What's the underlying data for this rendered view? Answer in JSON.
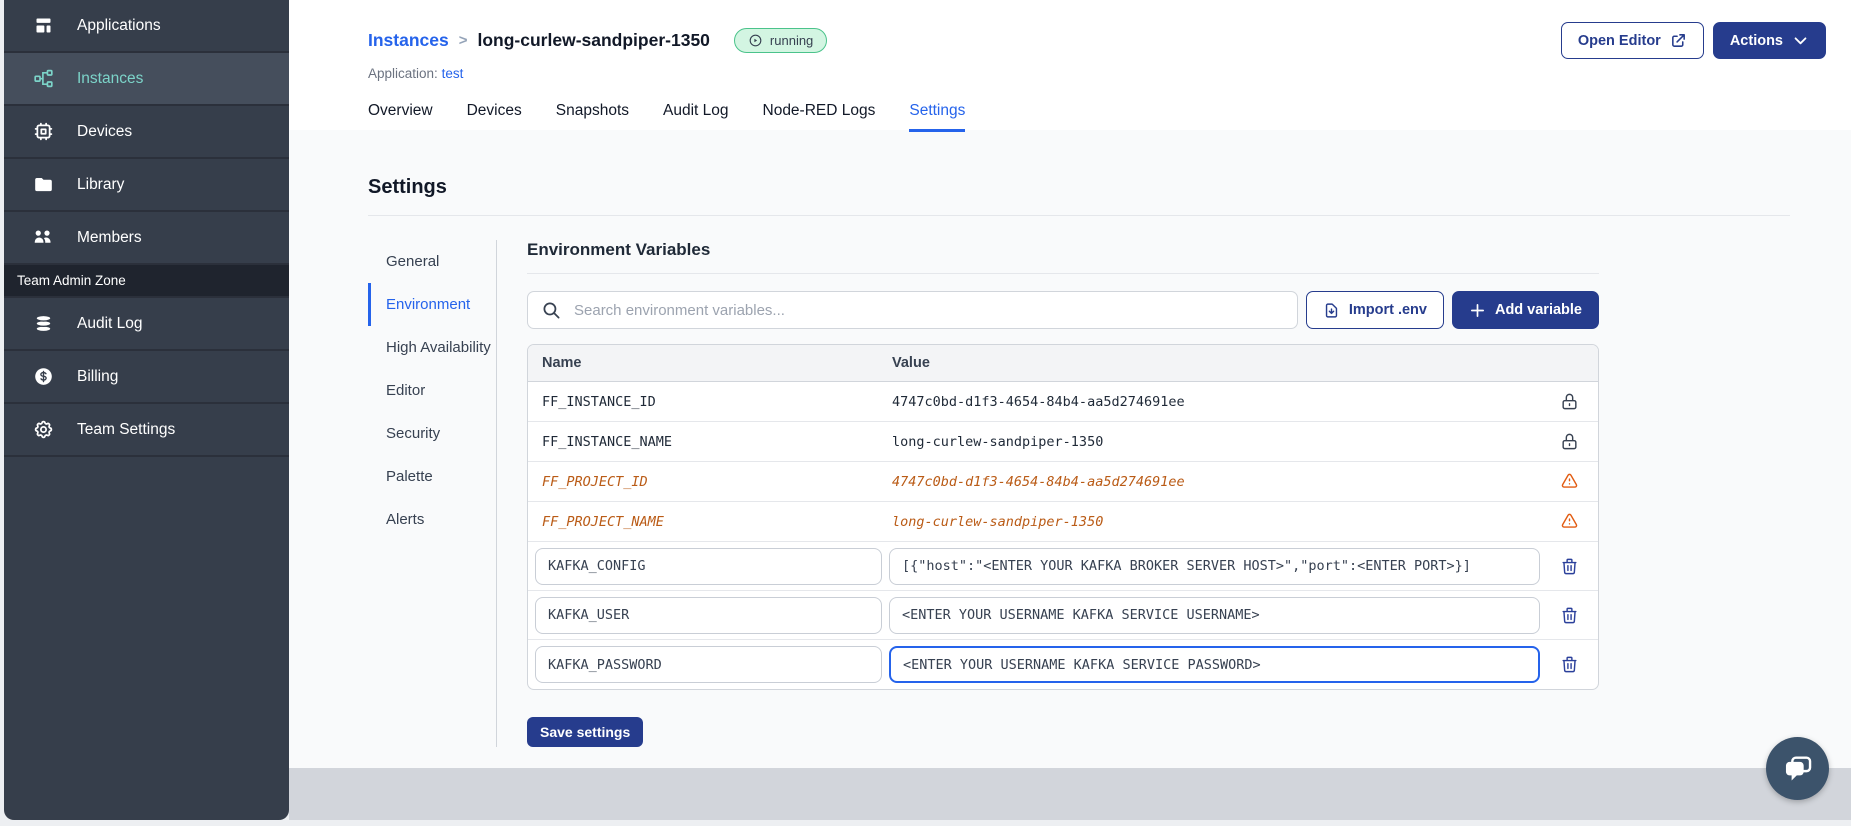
{
  "colors": {
    "brand_navy": "#263C8D",
    "link_blue": "#2563EB",
    "sidebar_bg": "#363E4B",
    "sidebar_active_teal": "#7CD4C9",
    "status_green_bg": "#D3F5E2",
    "status_green_border": "#4BC38B",
    "deprecated_orange": "#BA5B16",
    "warning_orange": "#E25C12"
  },
  "sidebar": {
    "items": [
      {
        "label": "Applications"
      },
      {
        "label": "Instances"
      },
      {
        "label": "Devices"
      },
      {
        "label": "Library"
      },
      {
        "label": "Members"
      }
    ],
    "section_label": "Team Admin Zone",
    "admin_items": [
      {
        "label": "Audit Log"
      },
      {
        "label": "Billing"
      },
      {
        "label": "Team Settings"
      }
    ]
  },
  "header": {
    "breadcrumb_parent": "Instances",
    "breadcrumb_separator": ">",
    "instance_name": "long-curlew-sandpiper-1350",
    "status_badge": "running",
    "application_label": "Application:",
    "application_name": "test",
    "open_editor_label": "Open Editor",
    "actions_label": "Actions"
  },
  "tabs": [
    {
      "label": "Overview"
    },
    {
      "label": "Devices"
    },
    {
      "label": "Snapshots"
    },
    {
      "label": "Audit Log"
    },
    {
      "label": "Node-RED Logs"
    },
    {
      "label": "Settings"
    }
  ],
  "settings": {
    "title": "Settings",
    "nav": [
      {
        "label": "General"
      },
      {
        "label": "Environment"
      },
      {
        "label": "High Availability"
      },
      {
        "label": "Editor"
      },
      {
        "label": "Security"
      },
      {
        "label": "Palette"
      },
      {
        "label": "Alerts"
      }
    ],
    "panel_title": "Environment Variables",
    "search_placeholder": "Search environment variables...",
    "import_button": "Import .env",
    "add_button": "Add variable",
    "save_button": "Save settings",
    "table": {
      "columns": [
        "Name",
        "Value"
      ],
      "rows": [
        {
          "name": "FF_INSTANCE_ID",
          "value": "4747c0bd-d1f3-4654-84b4-aa5d274691ee",
          "state": "locked"
        },
        {
          "name": "FF_INSTANCE_NAME",
          "value": "long-curlew-sandpiper-1350",
          "state": "locked"
        },
        {
          "name": "FF_PROJECT_ID",
          "value": "4747c0bd-d1f3-4654-84b4-aa5d274691ee",
          "state": "deprecated"
        },
        {
          "name": "FF_PROJECT_NAME",
          "value": "long-curlew-sandpiper-1350",
          "state": "deprecated"
        },
        {
          "name": "KAFKA_CONFIG",
          "value": "[{\"host\":\"<ENTER YOUR KAFKA BROKER SERVER HOST>\",\"port\":<ENTER PORT>}]",
          "state": "editable"
        },
        {
          "name": "KAFKA_USER",
          "value": "<ENTER YOUR USERNAME KAFKA SERVICE USERNAME>",
          "state": "editable"
        },
        {
          "name": "KAFKA_PASSWORD",
          "value": "<ENTER YOUR USERNAME KAFKA SERVICE PASSWORD>",
          "state": "editable",
          "focused": true
        }
      ]
    }
  }
}
